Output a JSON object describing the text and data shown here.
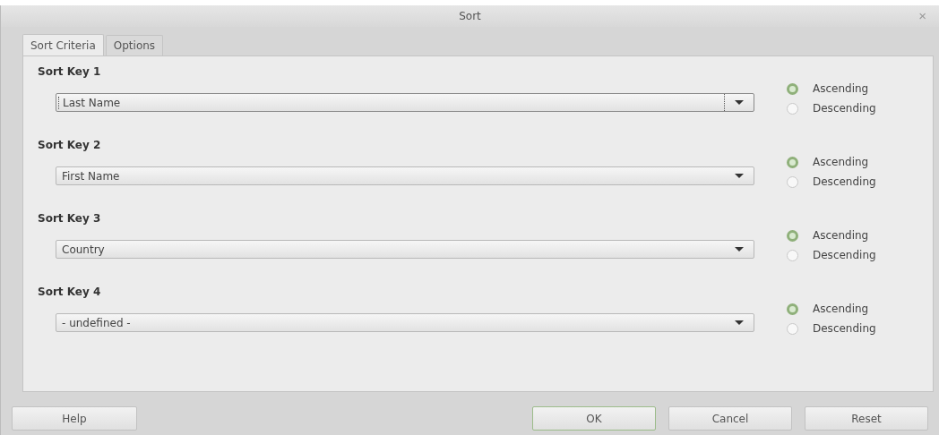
{
  "window": {
    "title": "Sort",
    "close": "×"
  },
  "tabs": [
    {
      "label": "Sort Criteria",
      "selected": true
    },
    {
      "label": "Options",
      "selected": false
    }
  ],
  "sort_keys": [
    {
      "label": "Sort Key 1",
      "value": "Last Name",
      "focused": true,
      "options": [
        {
          "label": "Ascending",
          "selected": true
        },
        {
          "label": "Descending",
          "selected": false
        }
      ]
    },
    {
      "label": "Sort Key 2",
      "value": "First Name",
      "focused": false,
      "options": [
        {
          "label": "Ascending",
          "selected": true
        },
        {
          "label": "Descending",
          "selected": false
        }
      ]
    },
    {
      "label": "Sort Key 3",
      "value": "Country",
      "focused": false,
      "options": [
        {
          "label": "Ascending",
          "selected": true
        },
        {
          "label": "Descending",
          "selected": false
        }
      ]
    },
    {
      "label": "Sort Key 4",
      "value": "- undefined -",
      "focused": false,
      "options": [
        {
          "label": "Ascending",
          "selected": true
        },
        {
          "label": "Descending",
          "selected": false
        }
      ]
    }
  ],
  "buttons": [
    {
      "label": "Help",
      "kind": "help",
      "default": false
    },
    {
      "label": "OK",
      "kind": "action",
      "default": true
    },
    {
      "label": "Cancel",
      "kind": "action",
      "default": false
    },
    {
      "label": "Reset",
      "kind": "action",
      "default": false
    }
  ]
}
